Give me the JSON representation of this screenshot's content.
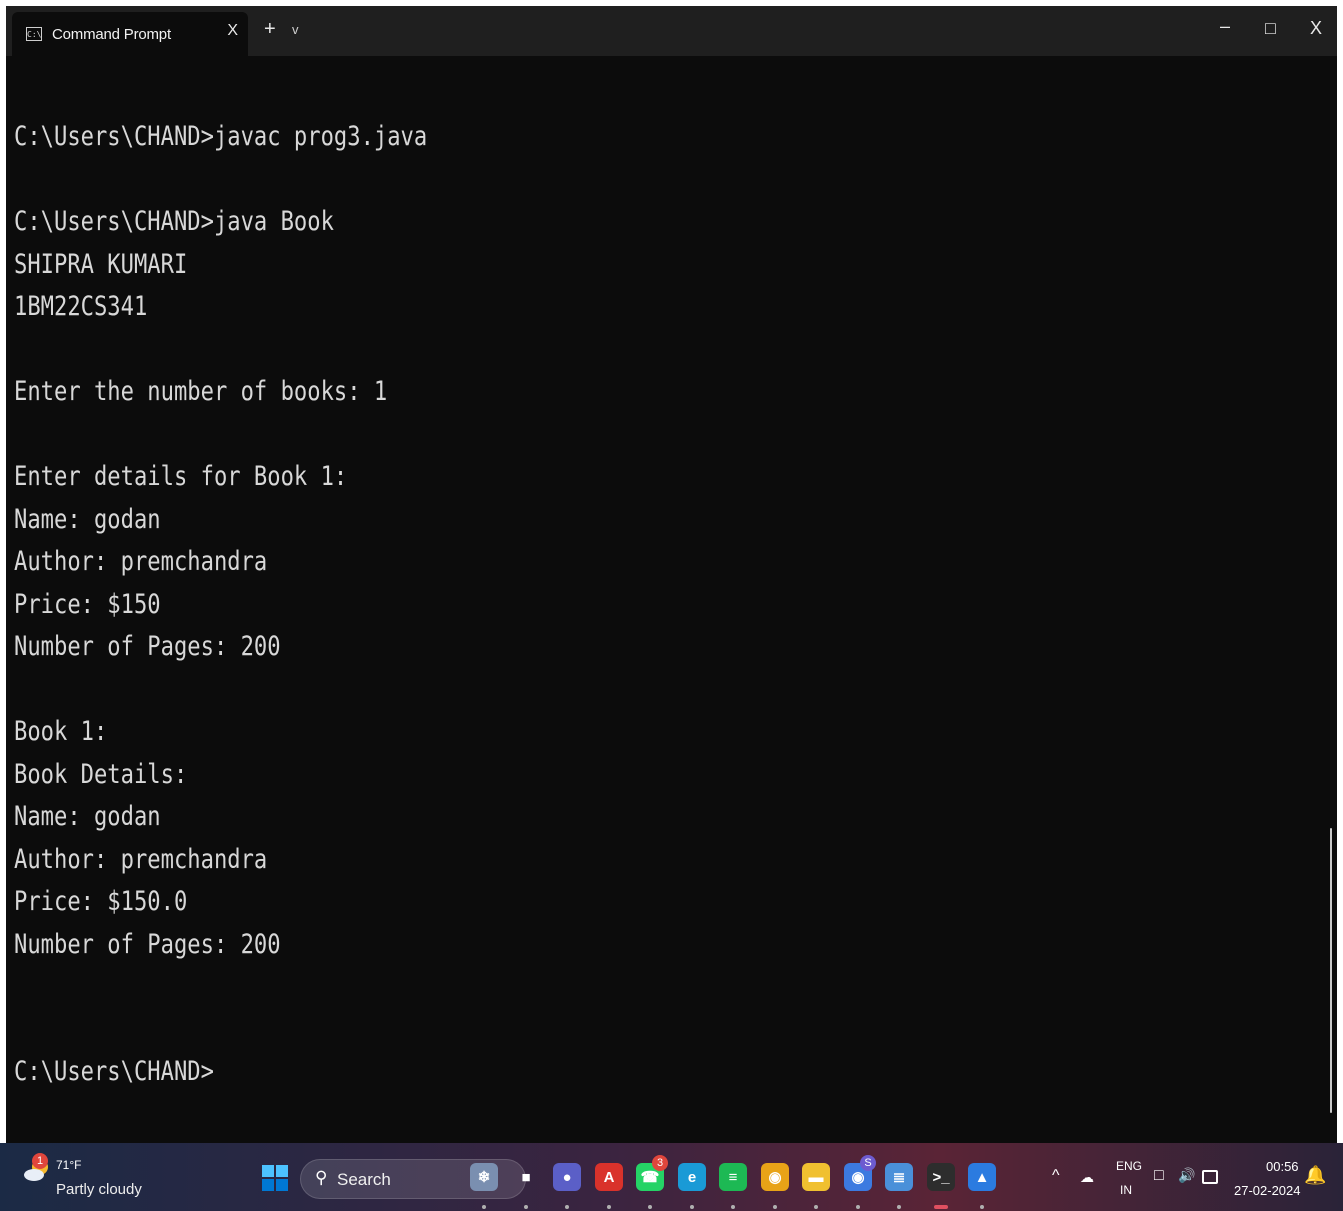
{
  "window": {
    "tab_icon_text": "C:\\",
    "tab_title": "Command Prompt",
    "tab_close": "X",
    "new_tab": "+",
    "tab_dropdown": "v",
    "minimize": "–",
    "maximize": "□",
    "close": "X"
  },
  "terminal": {
    "lines": [
      "C:\\Users\\CHAND>javac prog3.java",
      "",
      "C:\\Users\\CHAND>java Book",
      "SHIPRA KUMARI",
      "1BM22CS341",
      "",
      "Enter the number of books: 1",
      "",
      "Enter details for Book 1:",
      "Name: godan",
      "Author: premchandra",
      "Price: $150",
      "Number of Pages: 200",
      "",
      "Book 1:",
      "Book Details:",
      "Name: godan",
      "Author: premchandra",
      "Price: $150.0",
      "Number of Pages: 200",
      "",
      "",
      "C:\\Users\\CHAND>"
    ]
  },
  "taskbar": {
    "weather": {
      "temp": "71°F",
      "desc": "Partly cloudy",
      "badge": "1"
    },
    "search_label": "Search",
    "apps": [
      {
        "name": "snow-leopard-widget",
        "glyph": "❄",
        "bg": "#7a8fb0"
      },
      {
        "name": "task-view",
        "glyph": "■",
        "bg": "transparent"
      },
      {
        "name": "teams-meet",
        "glyph": "●",
        "bg": "#5b5fc7"
      },
      {
        "name": "adobe-acrobat",
        "glyph": "A",
        "bg": "#d9322b"
      },
      {
        "name": "whatsapp",
        "glyph": "☎",
        "bg": "#25d366",
        "badge": "3"
      },
      {
        "name": "edge",
        "glyph": "e",
        "bg": "#1a9ad6"
      },
      {
        "name": "spotify",
        "glyph": "≡",
        "bg": "#1db954"
      },
      {
        "name": "chrome-profile-1",
        "glyph": "◉",
        "bg": "#e8a317"
      },
      {
        "name": "file-explorer",
        "glyph": "▬",
        "bg": "#f0c030"
      },
      {
        "name": "chrome-profile-2",
        "glyph": "◉",
        "bg": "#3c7ae0",
        "badge": "S"
      },
      {
        "name": "notepad",
        "glyph": "≣",
        "bg": "#4a90d9"
      },
      {
        "name": "terminal",
        "glyph": ">_",
        "bg": "#2d2d2d"
      },
      {
        "name": "photos",
        "glyph": "▲",
        "bg": "#2b7be0"
      }
    ],
    "tray": {
      "lang_top": "ENG",
      "lang_bottom": "IN",
      "time": "00:56",
      "date": "27-02-2024"
    }
  }
}
